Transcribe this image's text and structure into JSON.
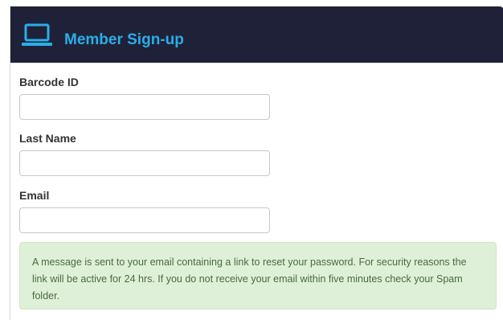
{
  "header": {
    "title": "Member Sign-up",
    "icon": "laptop-icon",
    "background_color": "#1f2138",
    "title_color": "#2aaee8"
  },
  "form": {
    "fields": [
      {
        "label": "Barcode ID",
        "value": "",
        "placeholder": ""
      },
      {
        "label": "Last Name",
        "value": "",
        "placeholder": ""
      },
      {
        "label": "Email",
        "value": "",
        "placeholder": ""
      }
    ]
  },
  "notice": {
    "text": "A message is sent to your email containing a link to reset your password. For security reasons the link will be active for 24 hrs. If you do not receive your email within five minutes check your Spam folder.",
    "background_color": "#dff0d8"
  }
}
